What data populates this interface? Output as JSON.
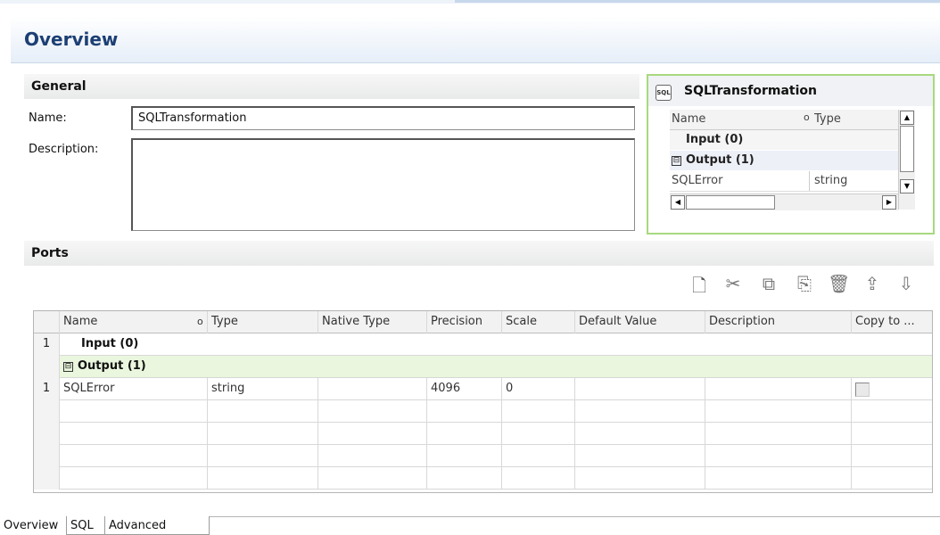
{
  "overview": {
    "title": "Overview"
  },
  "general": {
    "heading": "General",
    "name_label": "Name:",
    "name_value": "SQLTransformation",
    "description_label": "Description:",
    "description_value": ""
  },
  "transformation_box": {
    "icon_text": "SQL",
    "title": "SQLTransformation",
    "columns": [
      "Name",
      "Type"
    ],
    "input_group": "Input (0)",
    "output_group": "Output (1)",
    "rows": [
      {
        "name": "SQLError",
        "type": "string"
      }
    ],
    "toggle": "⊟"
  },
  "ports": {
    "heading": "Ports",
    "toolbar": [
      {
        "name": "new-port-icon",
        "glyph": "🗋"
      },
      {
        "name": "cut-icon",
        "glyph": "✂"
      },
      {
        "name": "copy-icon",
        "glyph": "⧉"
      },
      {
        "name": "paste-icon",
        "glyph": "📋"
      },
      {
        "name": "delete-icon",
        "glyph": "🗑"
      },
      {
        "name": "move-up-icon",
        "glyph": "⇪"
      },
      {
        "name": "move-down-icon",
        "glyph": "⇩"
      }
    ],
    "columns": [
      "Name",
      "Type",
      "Native Type",
      "Precision",
      "Scale",
      "Default Value",
      "Description",
      "Copy to ..."
    ],
    "input_group_index": "1",
    "input_group": "Input (0)",
    "output_group": "Output (1)",
    "toggle": "⊟",
    "rows": [
      {
        "index": "1",
        "name": "SQLError",
        "type": "string",
        "native_type": "",
        "precision": "4096",
        "scale": "0",
        "default_value": "",
        "description": ""
      }
    ]
  },
  "bottom_tabs": [
    "Overview",
    "SQL",
    "Advanced"
  ]
}
